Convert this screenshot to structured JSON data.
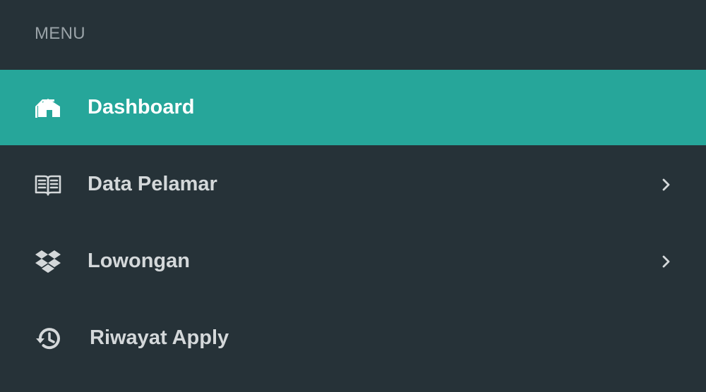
{
  "menu": {
    "header": "MENU",
    "items": [
      {
        "label": "Dashboard",
        "icon": "home-icon",
        "active": true,
        "has_submenu": false
      },
      {
        "label": "Data Pelamar",
        "icon": "book-icon",
        "active": false,
        "has_submenu": true
      },
      {
        "label": "Lowongan",
        "icon": "dropbox-icon",
        "active": false,
        "has_submenu": true
      },
      {
        "label": "Riwayat Apply",
        "icon": "history-icon",
        "active": false,
        "has_submenu": false
      }
    ]
  },
  "colors": {
    "background": "#263238",
    "active_background": "#26a69a",
    "active_text": "#ffffff",
    "text": "#d4d8da",
    "header_text": "#9aa3a8"
  }
}
